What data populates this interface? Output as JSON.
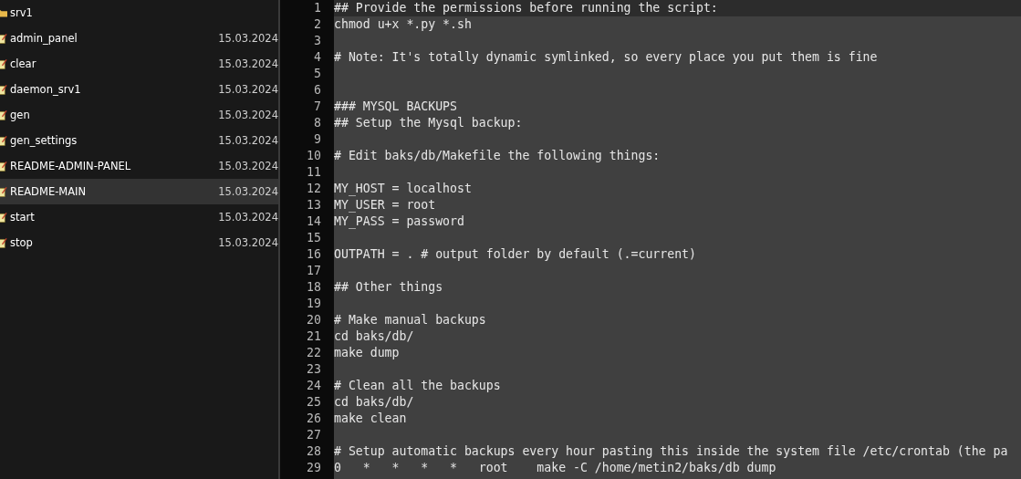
{
  "file_list": [
    {
      "name": "srv1",
      "kind": "folder",
      "selected": false
    },
    {
      "name": "admin_panel",
      "kind": "script",
      "date": "15.03.2024",
      "selected": false
    },
    {
      "name": "clear",
      "kind": "script",
      "date": "15.03.2024",
      "selected": false
    },
    {
      "name": "daemon_srv1",
      "kind": "script",
      "date": "15.03.2024",
      "selected": false
    },
    {
      "name": "gen",
      "kind": "script",
      "date": "15.03.2024",
      "selected": false
    },
    {
      "name": "gen_settings",
      "kind": "script",
      "date": "15.03.2024",
      "selected": false
    },
    {
      "name": "README-ADMIN-PANEL",
      "kind": "script",
      "date": "15.03.2024",
      "selected": false
    },
    {
      "name": "README-MAIN",
      "kind": "script",
      "date": "15.03.2024",
      "selected": true
    },
    {
      "name": "start",
      "kind": "script",
      "date": "15.03.2024",
      "selected": false
    },
    {
      "name": "stop",
      "kind": "script",
      "date": "15.03.2024",
      "selected": false
    }
  ],
  "editor": {
    "lines": [
      {
        "number": "1",
        "text": "## Provide the permissions before running the script:",
        "current": true
      },
      {
        "number": "2",
        "text": "chmod u+x *.py *.sh",
        "current": false
      },
      {
        "number": "3",
        "current": false
      },
      {
        "number": "4",
        "text": "# Note: It's totally dynamic symlinked, so every place you put them is fine",
        "current": false
      },
      {
        "number": "5",
        "current": false
      },
      {
        "number": "6",
        "current": false
      },
      {
        "number": "7",
        "text": "### MYSQL BACKUPS",
        "current": false
      },
      {
        "number": "8",
        "text": "## Setup the Mysql backup:",
        "current": false
      },
      {
        "number": "9",
        "current": false
      },
      {
        "number": "10",
        "text": "# Edit baks/db/Makefile the following things:",
        "current": false
      },
      {
        "number": "11",
        "current": false
      },
      {
        "number": "12",
        "text": "MY_HOST = localhost",
        "current": false
      },
      {
        "number": "13",
        "text": "MY_USER = root",
        "current": false
      },
      {
        "number": "14",
        "text": "MY_PASS = password",
        "current": false
      },
      {
        "number": "15",
        "current": false
      },
      {
        "number": "16",
        "text": "OUTPATH = . # output folder by default (.=current)",
        "current": false
      },
      {
        "number": "17",
        "current": false
      },
      {
        "number": "18",
        "text": "## Other things",
        "current": false
      },
      {
        "number": "19",
        "current": false
      },
      {
        "number": "20",
        "text": "# Make manual backups",
        "current": false
      },
      {
        "number": "21",
        "text": "cd baks/db/",
        "current": false
      },
      {
        "number": "22",
        "text": "make dump",
        "current": false
      },
      {
        "number": "23",
        "current": false
      },
      {
        "number": "24",
        "text": "# Clean all the backups",
        "current": false
      },
      {
        "number": "25",
        "text": "cd baks/db/",
        "current": false
      },
      {
        "number": "26",
        "text": "make clean",
        "current": false
      },
      {
        "number": "27",
        "current": false
      },
      {
        "number": "28",
        "text": "# Setup automatic backups every hour pasting this inside the system file /etc/crontab (the pa",
        "current": false
      },
      {
        "number": "29",
        "text": "0\t*\t*\t*\t*\troot\tmake -C /home/metin2/baks/db dump",
        "current": false
      }
    ]
  }
}
